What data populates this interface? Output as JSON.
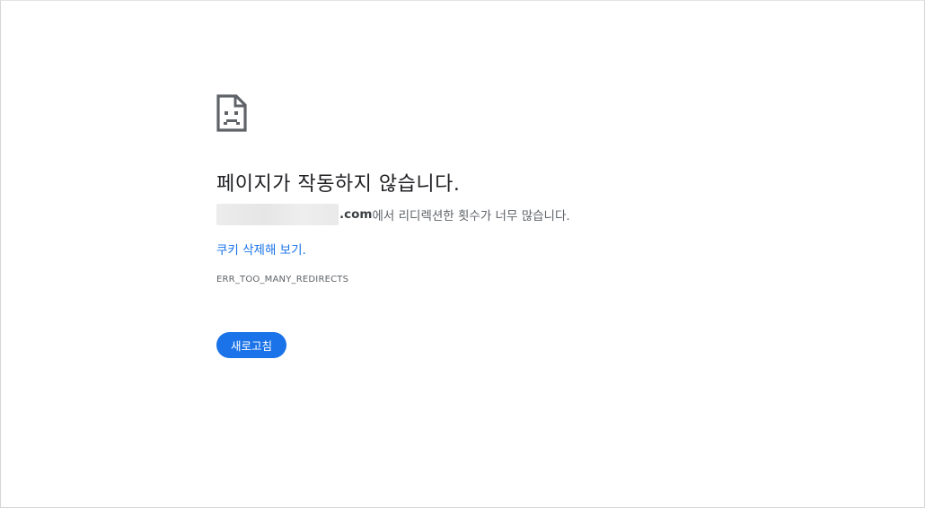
{
  "page": {
    "title": "페이지가 작동하지 않습니다.",
    "icon": "sad-page-icon"
  },
  "reason": {
    "domain": ".com",
    "message": "에서 리디렉션한 횟수가 너무 많습니다."
  },
  "suggestion": {
    "link_label": "쿠키 삭제해 보기."
  },
  "error_code": "ERR_TOO_MANY_REDIRECTS",
  "actions": {
    "reload_label": "새로고침"
  },
  "colors": {
    "link": "#1a73e8",
    "button_bg": "#1a73e8",
    "title": "#202124",
    "secondary_text": "#5f6368"
  }
}
